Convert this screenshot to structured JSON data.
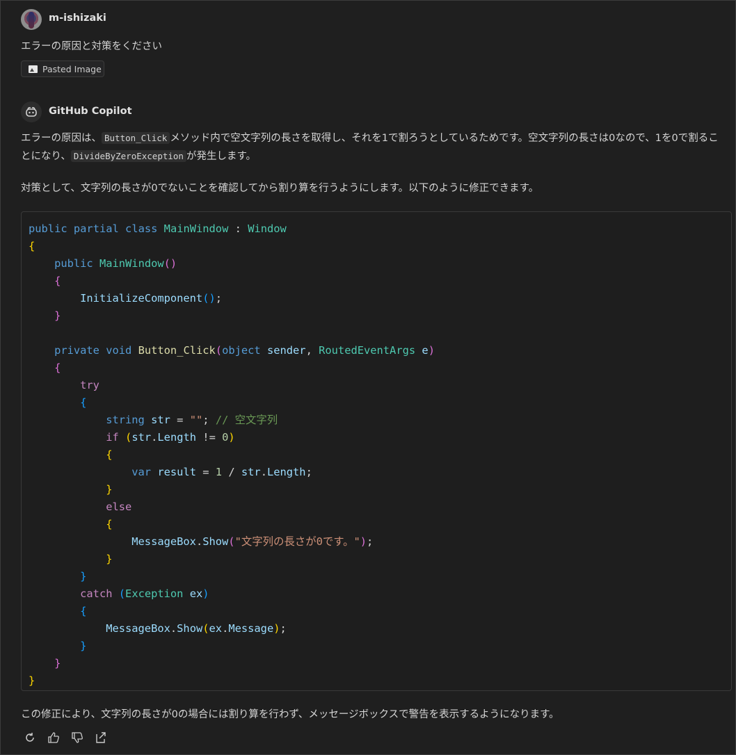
{
  "user": {
    "name": "m-ishizaki",
    "message": "エラーの原因と対策をください",
    "attachment_label": "Pasted Image"
  },
  "assistant": {
    "name": "GitHub Copilot",
    "para1_a": "エラーの原因は、",
    "para1_code1": "Button_Click",
    "para1_b": "メソッド内で空文字列の長さを取得し、それを1で割ろうとしているためです。空文字列の長さは0なので、1を0で割ることになり、",
    "para1_code2": "DivideByZeroException",
    "para1_c": "が発生します。",
    "para2": "対策として、文字列の長さが0でないことを確認してから割り算を行うようにします。以下のように修正できます。",
    "footer": "この修正により、文字列の長さが0の場合には割り算を行わず、メッセージボックスで警告を表示するようになります。",
    "code": {
      "class_line": [
        "public",
        "partial",
        "class",
        "MainWindow",
        ":",
        "Window"
      ],
      "ctor": "MainWindow",
      "init": "InitializeComponent",
      "method": "Button_Click",
      "param1_type": "object",
      "param1_name": "sender",
      "param2_type": "RoutedEventArgs",
      "param2_name": "e",
      "str_decl": "string",
      "str_name": "str",
      "str_value": "\"\"",
      "comment": "// 空文字列",
      "if_kw": "if",
      "if_cond_obj": "str",
      "if_cond_prop": "Length",
      "if_op": "!=",
      "if_num": "0",
      "var_kw": "var",
      "result_name": "result",
      "one": "1",
      "msg_class": "MessageBox",
      "msg_method": "Show",
      "msg_text": "\"文字列の長さが0です。\"",
      "catch_type": "Exception",
      "catch_var": "ex",
      "ex_prop": "Message"
    }
  },
  "actions": {
    "icons": [
      "retry-icon",
      "thumbs-up-icon",
      "thumbs-down-icon",
      "export-icon"
    ]
  }
}
